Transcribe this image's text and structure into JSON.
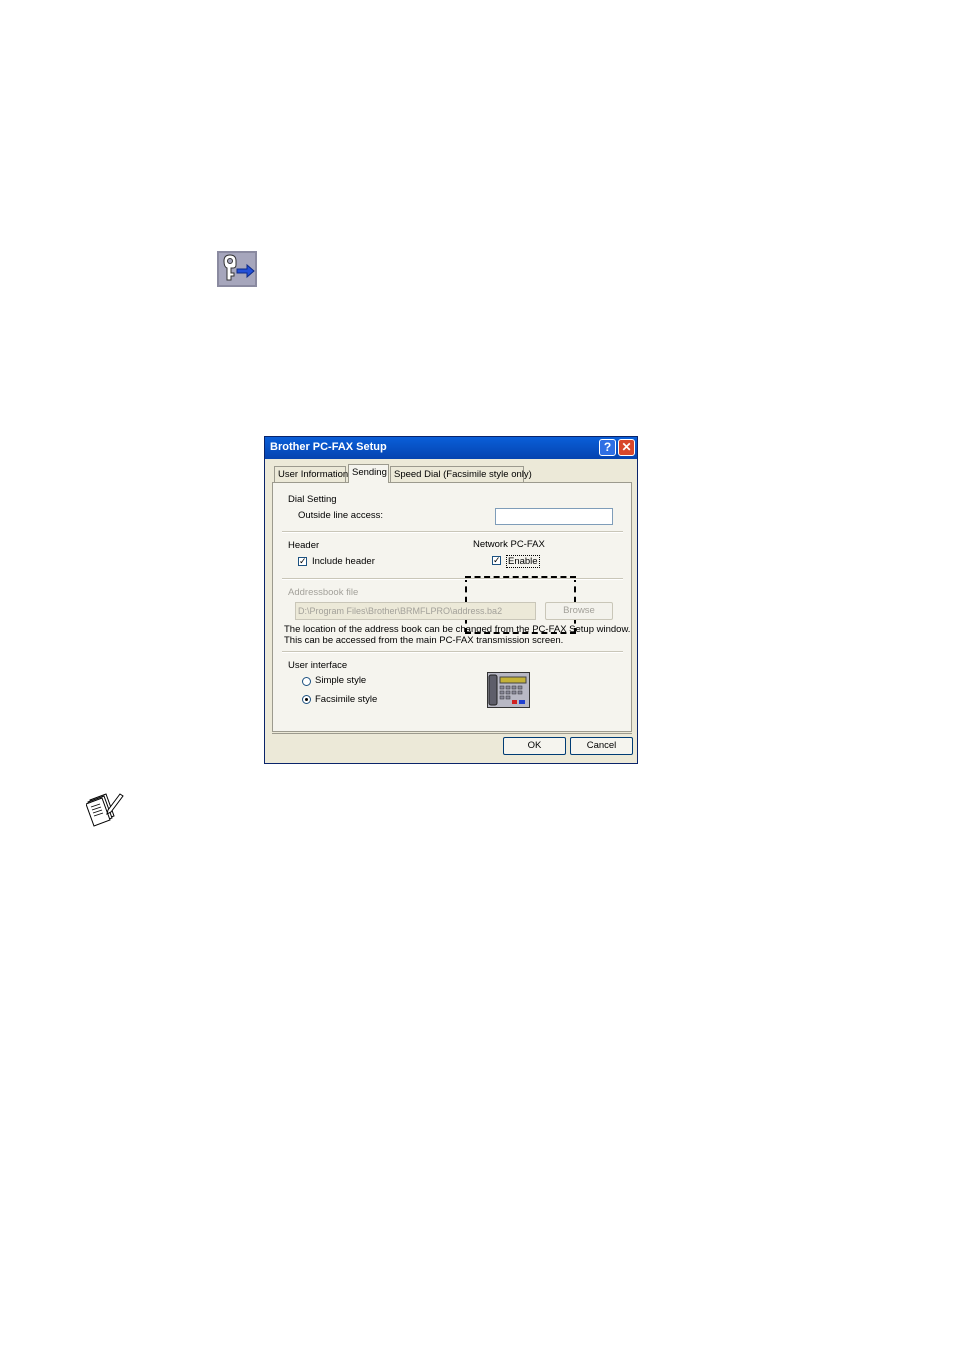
{
  "dialog": {
    "title": "Brother PC-FAX Setup",
    "help_button": "?",
    "close_button": "✕",
    "tabs": [
      {
        "label": "User Information"
      },
      {
        "label": "Sending"
      },
      {
        "label": "Speed Dial (Facsimile style only)"
      }
    ],
    "dial_setting": {
      "group_label": "Dial Setting",
      "outside_line_label": "Outside line access:",
      "outside_line_value": ""
    },
    "header": {
      "group_label": "Header",
      "include_header_label": "Include header",
      "include_header_checked": true
    },
    "network_pcfax": {
      "group_label": "Network PC-FAX",
      "enable_label": "Enable",
      "enable_checked": true
    },
    "addressbook": {
      "group_label": "Addressbook file",
      "path": "D:\\Program Files\\Brother\\BRMFLPRO\\address.ba2",
      "browse_label": "Browse",
      "note_line1": "The location of the address book can be changed from the PC-FAX Setup window.",
      "note_line2": "This can be accessed from the main PC-FAX transmission screen."
    },
    "user_interface": {
      "group_label": "User interface",
      "simple_label": "Simple style",
      "facsimile_label": "Facsimile style",
      "selected": "Facsimile style"
    },
    "ok_label": "OK",
    "cancel_label": "Cancel"
  },
  "icons": {
    "setup_icon": "pcfax-setup-icon",
    "phone_icon": "fax-phone-icon",
    "note_icon": "note-icon"
  }
}
